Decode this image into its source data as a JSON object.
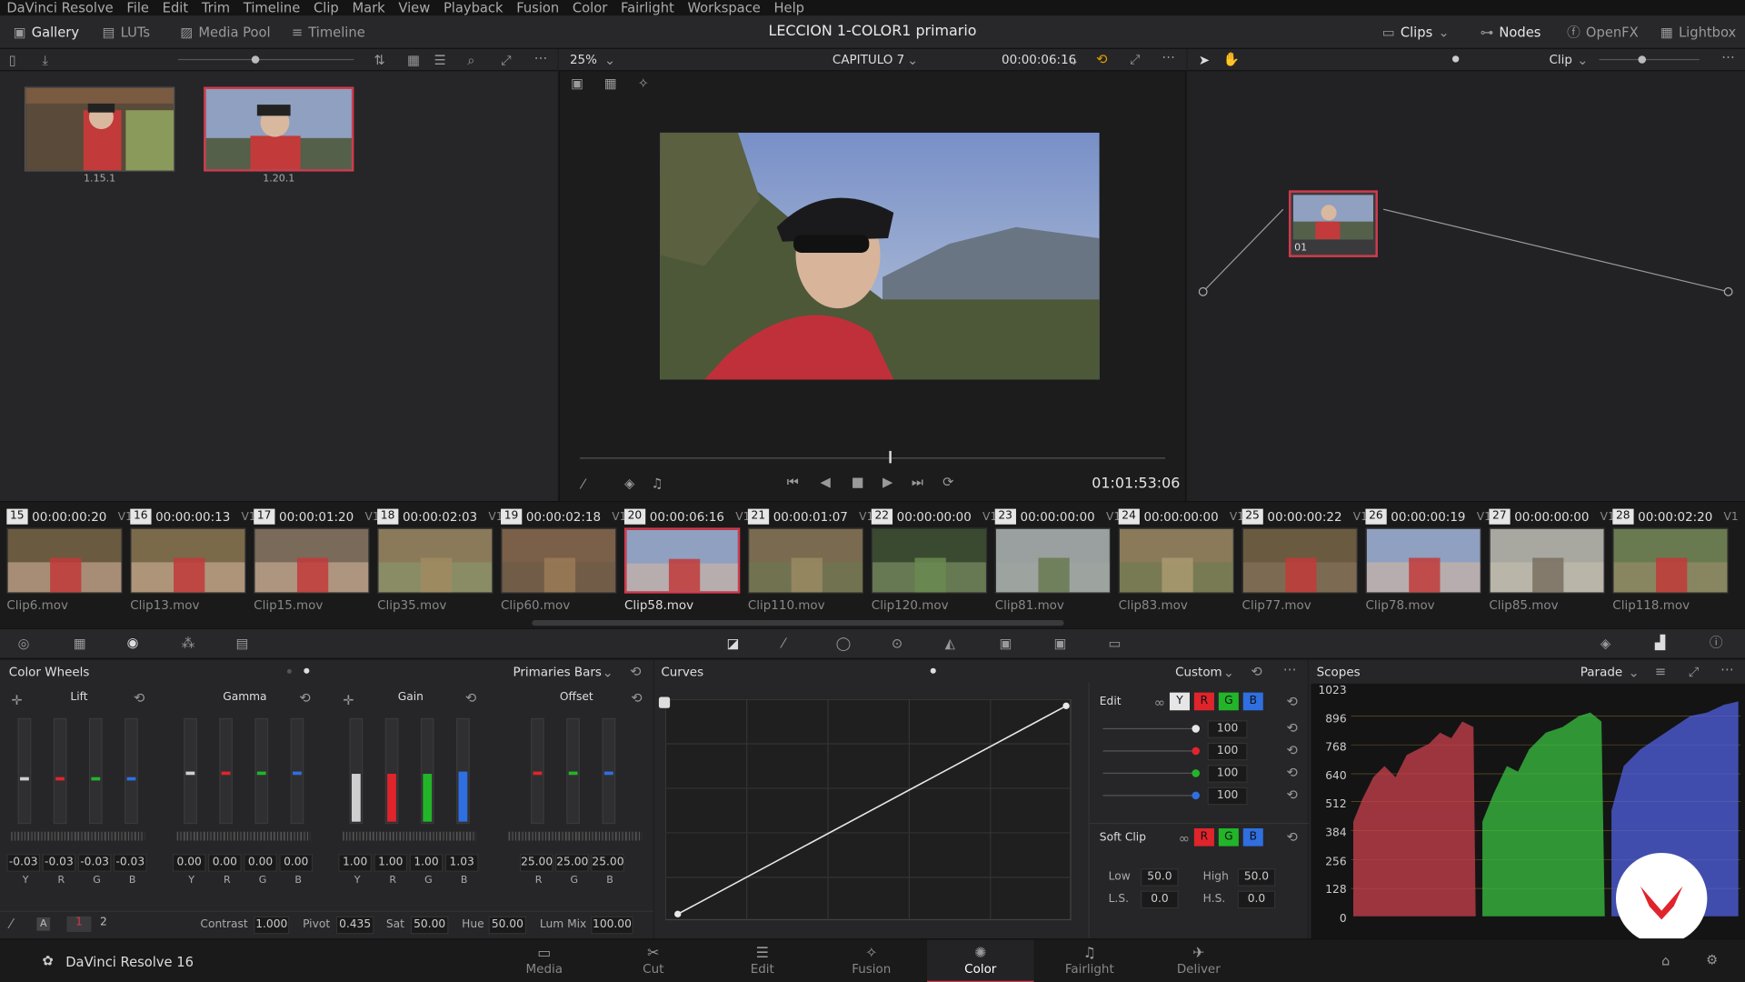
{
  "menu": [
    "DaVinci Resolve",
    "File",
    "Edit",
    "Trim",
    "Timeline",
    "Clip",
    "Mark",
    "View",
    "Playback",
    "Fusion",
    "Color",
    "Fairlight",
    "Workspace",
    "Help"
  ],
  "topbar": {
    "gallery": "Gallery",
    "luts": "LUTs",
    "media_pool": "Media Pool",
    "timeline": "Timeline",
    "project_title": "LECCION 1-COLOR1 primario",
    "clips": "Clips",
    "nodes": "Nodes",
    "openfx": "OpenFX",
    "lightbox": "Lightbox"
  },
  "gallery": {
    "stills": [
      {
        "label": "1.15.1"
      },
      {
        "label": "1.20.1"
      }
    ]
  },
  "viewer": {
    "zoom": "25%",
    "timeline_name": "CAPITULO 7",
    "clip_timecode": "00:00:06:16",
    "record_timecode": "01:01:53:06"
  },
  "nodes": {
    "mode": "Clip",
    "node_label": "01"
  },
  "clips": [
    {
      "num": "15",
      "tc": "00:00:00:20",
      "track": "V1",
      "name": "Clip6.mov"
    },
    {
      "num": "16",
      "tc": "00:00:00:13",
      "track": "V1",
      "name": "Clip13.mov"
    },
    {
      "num": "17",
      "tc": "00:00:01:20",
      "track": "V1",
      "name": "Clip15.mov"
    },
    {
      "num": "18",
      "tc": "00:00:02:03",
      "track": "V1",
      "name": "Clip35.mov"
    },
    {
      "num": "19",
      "tc": "00:00:02:18",
      "track": "V1",
      "name": "Clip60.mov"
    },
    {
      "num": "20",
      "tc": "00:00:06:16",
      "track": "V1",
      "name": "Clip58.mov"
    },
    {
      "num": "21",
      "tc": "00:00:01:07",
      "track": "V1",
      "name": "Clip110.mov"
    },
    {
      "num": "22",
      "tc": "00:00:00:00",
      "track": "V1",
      "name": "Clip120.mov"
    },
    {
      "num": "23",
      "tc": "00:00:00:00",
      "track": "V1",
      "name": "Clip81.mov"
    },
    {
      "num": "24",
      "tc": "00:00:00:00",
      "track": "V1",
      "name": "Clip83.mov"
    },
    {
      "num": "25",
      "tc": "00:00:00:22",
      "track": "V1",
      "name": "Clip77.mov"
    },
    {
      "num": "26",
      "tc": "00:00:00:19",
      "track": "V1",
      "name": "Clip78.mov"
    },
    {
      "num": "27",
      "tc": "00:00:00:00",
      "track": "V1",
      "name": "Clip85.mov"
    },
    {
      "num": "28",
      "tc": "00:00:02:20",
      "track": "V1",
      "name": "Clip118.mov"
    }
  ],
  "color_wheels": {
    "title": "Color Wheels",
    "mode": "Primaries Bars",
    "lift": {
      "label": "Lift",
      "values": [
        "-0.03",
        "-0.03",
        "-0.03",
        "-0.03"
      ],
      "channels": [
        "Y",
        "R",
        "G",
        "B"
      ]
    },
    "gamma": {
      "label": "Gamma",
      "values": [
        "0.00",
        "0.00",
        "0.00",
        "0.00"
      ],
      "channels": [
        "Y",
        "R",
        "G",
        "B"
      ]
    },
    "gain": {
      "label": "Gain",
      "values": [
        "1.00",
        "1.00",
        "1.00",
        "1.03"
      ],
      "channels": [
        "Y",
        "R",
        "G",
        "B"
      ]
    },
    "offset": {
      "label": "Offset",
      "values": [
        "25.00",
        "25.00",
        "25.00"
      ],
      "channels": [
        "R",
        "G",
        "B"
      ]
    },
    "page1": "1",
    "page2": "2",
    "contrast_label": "Contrast",
    "contrast": "1.000",
    "pivot_label": "Pivot",
    "pivot": "0.435",
    "sat_label": "Sat",
    "sat": "50.00",
    "hue_label": "Hue",
    "hue": "50.00",
    "lummix_label": "Lum Mix",
    "lummix": "100.00"
  },
  "curves": {
    "title": "Curves",
    "mode": "Custom",
    "edit_label": "Edit",
    "channel_y": "Y",
    "channel_r": "R",
    "channel_g": "G",
    "channel_b": "B",
    "intensities": [
      "100",
      "100",
      "100",
      "100"
    ],
    "soft_clip_label": "Soft Clip",
    "low_label": "Low",
    "low": "50.0",
    "high_label": "High",
    "high": "50.0",
    "ls_label": "L.S.",
    "ls": "0.0",
    "hs_label": "H.S.",
    "hs": "0.0"
  },
  "scopes": {
    "title": "Scopes",
    "mode": "Parade",
    "scale": [
      "1023",
      "896",
      "768",
      "640",
      "512",
      "384",
      "256",
      "128",
      "0"
    ]
  },
  "bottom_nav": {
    "app": "DaVinci Resolve 16",
    "pages": [
      "Media",
      "Cut",
      "Edit",
      "Fusion",
      "Color",
      "Fairlight",
      "Deliver"
    ],
    "active": "Color"
  },
  "colors": {
    "accent": "#d13b4c",
    "red": "#e0242c",
    "green": "#22b529",
    "blue": "#2f6fe0"
  }
}
